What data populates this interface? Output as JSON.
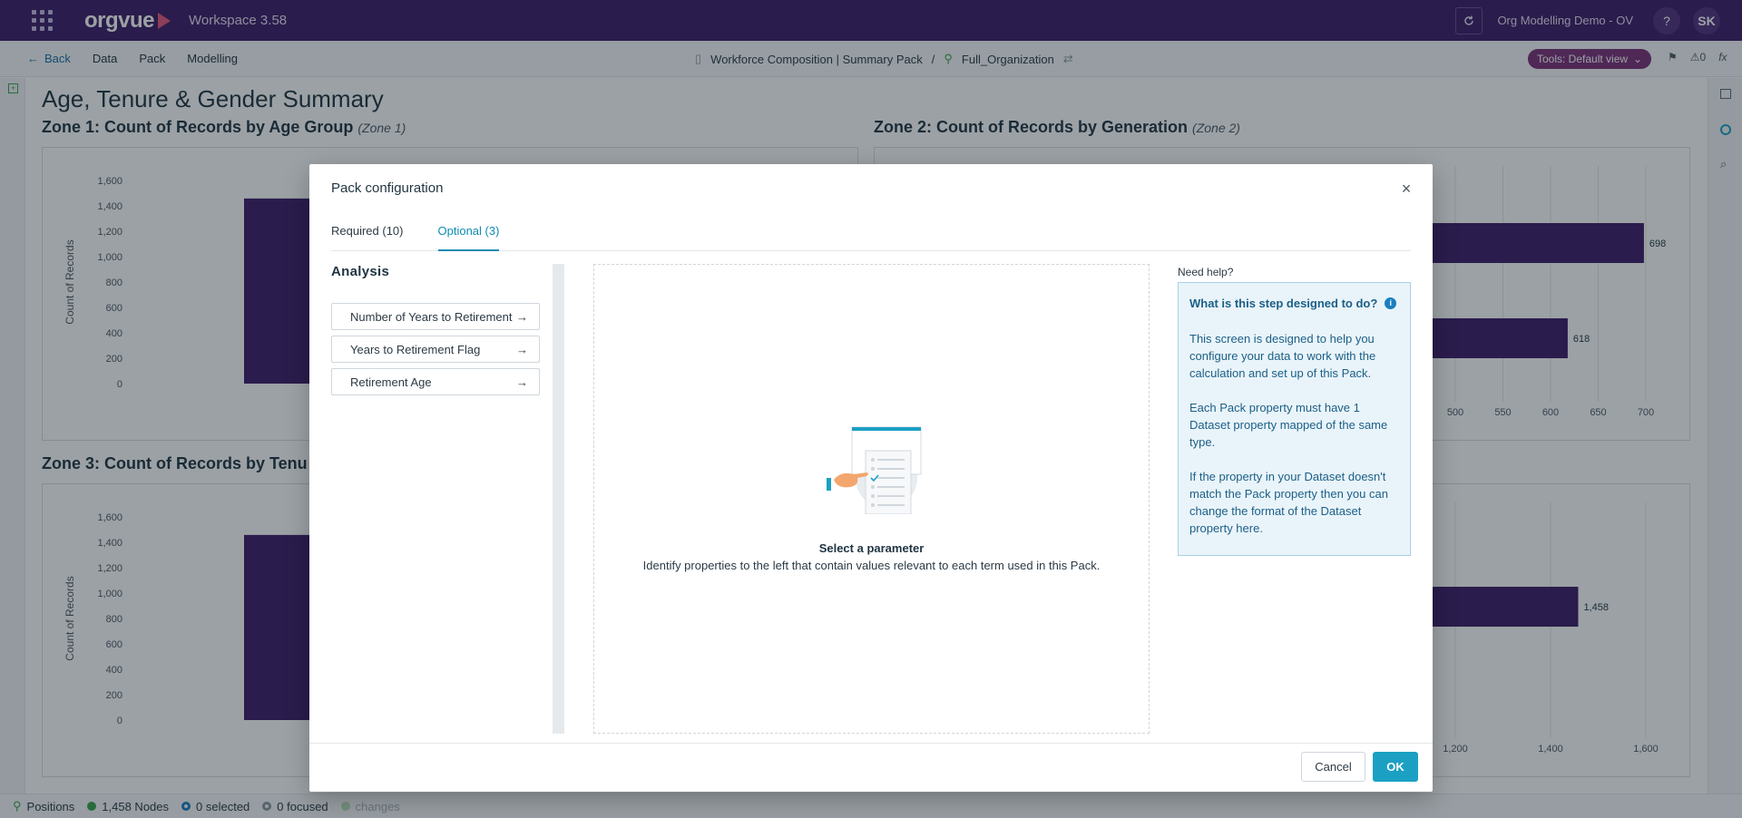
{
  "app": {
    "logo_text": "orgvue",
    "workspace_title": "Workspace 3.58",
    "org_name": "Org Modelling Demo - OV",
    "help_label": "?",
    "user_initials": "SK"
  },
  "subnav": {
    "back_label": "Back",
    "items": [
      "Data",
      "Pack",
      "Modelling"
    ],
    "pack_name": "Workforce Composition | Summary Pack",
    "separator": "/",
    "dataset_name": "Full_Organization",
    "tools_label": "Tools: Default view",
    "warnings_count": "0"
  },
  "page": {
    "title": "Age, Tenure & Gender Summary",
    "zones": [
      {
        "title": "Zone 1: Count of Records by Age Group",
        "suffix": "(Zone 1)"
      },
      {
        "title": "Zone 2: Count of Records by Generation",
        "suffix": "(Zone 2)"
      },
      {
        "title": "Zone 3: Count of Records by Tenu",
        "suffix": ""
      }
    ]
  },
  "chart_data": [
    {
      "type": "bar",
      "ylabel": "Count of Records",
      "y_ticks": [
        "1,600",
        "1,400",
        "1,200",
        "1,000",
        "800",
        "600",
        "400",
        "200",
        "0"
      ],
      "ylim": [
        0,
        1600
      ],
      "values": [
        1458
      ]
    },
    {
      "type": "bar",
      "orientation": "horizontal",
      "x_ticks": [
        "500",
        "550",
        "600",
        "650",
        "700"
      ],
      "data_labels": [
        "698",
        "618"
      ],
      "values": [
        698,
        618
      ]
    },
    {
      "type": "bar",
      "ylabel": "Count of Records",
      "y_ticks": [
        "1,600",
        "1,400",
        "1,200",
        "1,000",
        "800",
        "600",
        "400",
        "200",
        "0"
      ],
      "ylim": [
        0,
        1600
      ],
      "values": [
        1458
      ]
    },
    {
      "type": "bar",
      "orientation": "horizontal",
      "x_ticks": [
        "1,200",
        "1,400",
        "1,600"
      ],
      "data_labels": [
        "1,458"
      ],
      "values": [
        1458
      ]
    }
  ],
  "statusbar": {
    "positions_label": "Positions",
    "nodes_label": "1,458 Nodes",
    "selected_label": "0 selected",
    "focused_label": "0 focused",
    "changes_label": "changes"
  },
  "modal": {
    "title": "Pack configuration",
    "close_label": "×",
    "tabs": [
      {
        "label": "Required (10)",
        "active": false
      },
      {
        "label": "Optional (3)",
        "active": true
      }
    ],
    "section_title": "Analysis",
    "parameters": [
      {
        "label": "Number of Years to Retirement"
      },
      {
        "label": "Years to Retirement Flag"
      },
      {
        "label": "Retirement Age"
      }
    ],
    "empty_state": {
      "title": "Select a parameter",
      "description": "Identify properties to the left that contain values relevant to each term used in this Pack."
    },
    "help": {
      "heading": "Need help?",
      "question": "What is this step designed to do?",
      "paragraphs": [
        "This screen is designed to help you configure your data to work with the calculation and set up of this Pack.",
        "Each Pack property must have 1 Dataset property mapped of the same type.",
        "If the property in your Dataset doesn't match the Pack property then you can change the format of the Dataset property here."
      ]
    },
    "cancel_label": "Cancel",
    "ok_label": "OK"
  },
  "colors": {
    "topbar": "#3c1a66",
    "bar_fill": "#3c1a66",
    "accent": "#1ba0c4",
    "tools_pill": "#7a2f78"
  }
}
